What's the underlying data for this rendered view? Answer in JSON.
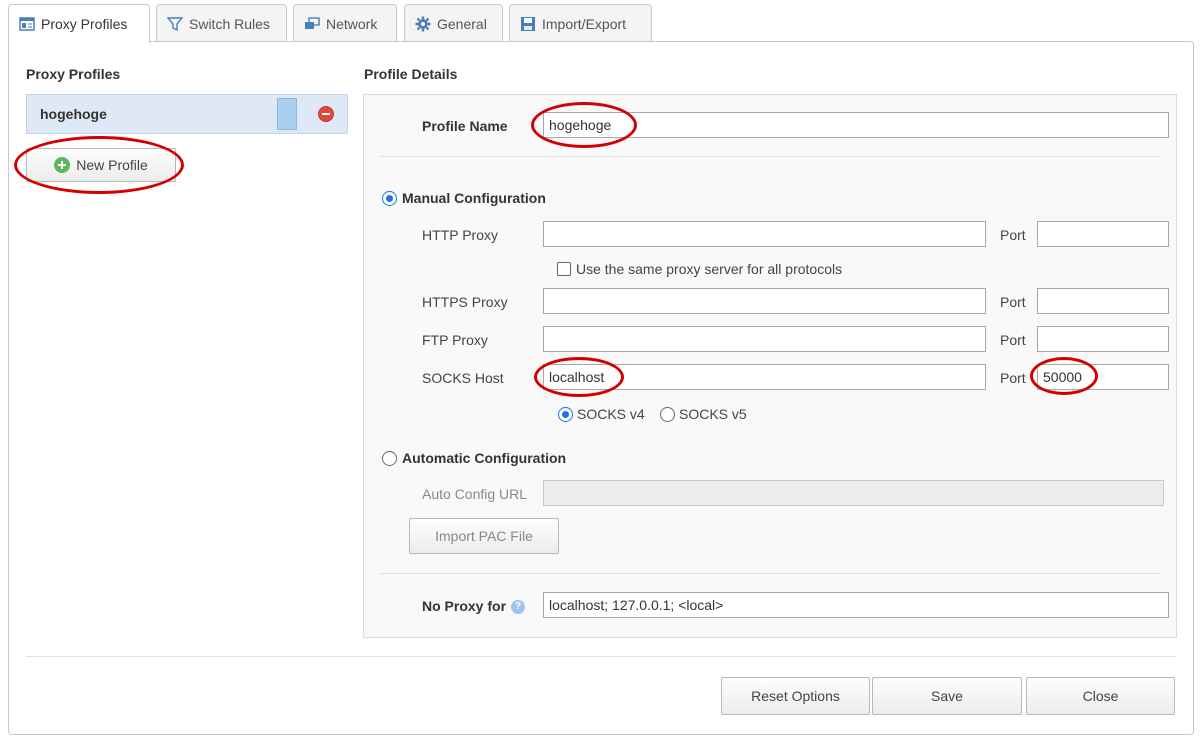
{
  "tabs": [
    {
      "label": "Proxy Profiles",
      "icon": "profiles-icon",
      "active": true
    },
    {
      "label": "Switch Rules",
      "icon": "filter-icon",
      "active": false
    },
    {
      "label": "Network",
      "icon": "network-icon",
      "active": false
    },
    {
      "label": "General",
      "icon": "gear-icon",
      "active": false
    },
    {
      "label": "Import/Export",
      "icon": "save-icon",
      "active": false
    }
  ],
  "left": {
    "title": "Proxy Profiles",
    "profiles": [
      {
        "name": "hogehoge",
        "color": "#a9d0f1"
      }
    ],
    "new_profile_label": "New Profile"
  },
  "details": {
    "title": "Profile Details",
    "profile_name_label": "Profile Name",
    "profile_name_value": "hogehoge",
    "manual_label": "Manual Configuration",
    "manual_selected": true,
    "http_label": "HTTP Proxy",
    "http_value": "",
    "http_port": "",
    "port_label": "Port",
    "same_proxy_label": "Use the same proxy server for all protocols",
    "same_proxy_checked": false,
    "https_label": "HTTPS Proxy",
    "https_value": "",
    "https_port": "",
    "ftp_label": "FTP Proxy",
    "ftp_value": "",
    "ftp_port": "",
    "socks_label": "SOCKS Host",
    "socks_value": "localhost",
    "socks_port": "50000",
    "socks_v4_label": "SOCKS v4",
    "socks_v5_label": "SOCKS v5",
    "socks_version": "v4",
    "auto_label": "Automatic Configuration",
    "auto_url_label": "Auto Config URL",
    "auto_url_value": "",
    "import_pac_label": "Import PAC File",
    "no_proxy_label": "No Proxy for",
    "no_proxy_value": "localhost; 127.0.0.1; <local>"
  },
  "footer": {
    "reset_label": "Reset Options",
    "save_label": "Save",
    "close_label": "Close"
  },
  "colors": {
    "accent": "#1a73e8",
    "annotation": "#d40000",
    "profile_bg": "#dfe9f6"
  }
}
